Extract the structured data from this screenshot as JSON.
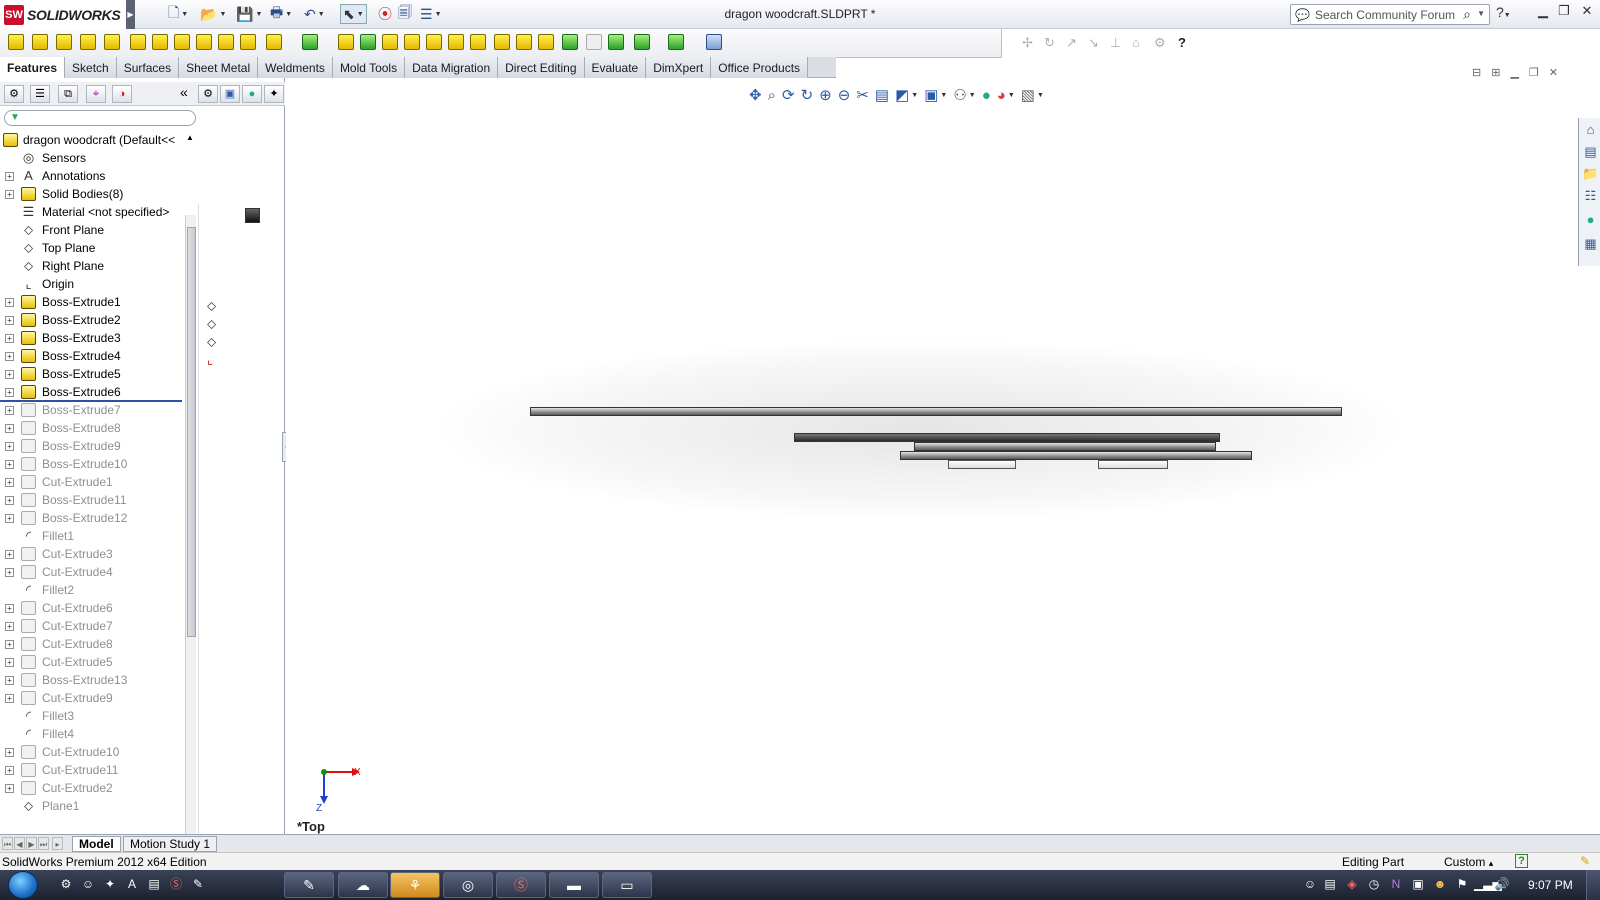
{
  "app": {
    "brand": "SOLIDWORKS",
    "brand_letters": "SW",
    "document_title": "dragon woodcraft.SLDPRT *",
    "search_placeholder": "Search Community Forum",
    "help_glyph": "?",
    "window_controls": [
      "minimize-icon",
      "restore-icon",
      "close-icon"
    ]
  },
  "tabs": [
    "Features",
    "Sketch",
    "Surfaces",
    "Sheet Metal",
    "Weldments",
    "Mold Tools",
    "Data Migration",
    "Direct Editing",
    "Evaluate",
    "DimXpert",
    "Office Products"
  ],
  "active_tab": "Features",
  "feature_tree": {
    "root": "dragon woodcraft  (Default<<",
    "items": [
      {
        "label": "Sensors",
        "icon": "sensor-icon",
        "expandable": false,
        "suppressed": false
      },
      {
        "label": "Annotations",
        "icon": "annotations-icon",
        "expandable": true,
        "suppressed": false
      },
      {
        "label": "Solid Bodies(8)",
        "icon": "solid-bodies-icon",
        "expandable": true,
        "suppressed": false
      },
      {
        "label": "Material <not specified>",
        "icon": "material-icon",
        "expandable": false,
        "suppressed": false
      },
      {
        "label": "Front Plane",
        "icon": "plane-icon",
        "expandable": false,
        "suppressed": false
      },
      {
        "label": "Top Plane",
        "icon": "plane-icon",
        "expandable": false,
        "suppressed": false
      },
      {
        "label": "Right Plane",
        "icon": "plane-icon",
        "expandable": false,
        "suppressed": false
      },
      {
        "label": "Origin",
        "icon": "origin-icon",
        "expandable": false,
        "suppressed": false
      },
      {
        "label": "Boss-Extrude1",
        "icon": "extrude-icon",
        "expandable": true,
        "suppressed": false
      },
      {
        "label": "Boss-Extrude2",
        "icon": "extrude-icon",
        "expandable": true,
        "suppressed": false
      },
      {
        "label": "Boss-Extrude3",
        "icon": "extrude-icon",
        "expandable": true,
        "suppressed": false
      },
      {
        "label": "Boss-Extrude4",
        "icon": "extrude-icon",
        "expandable": true,
        "suppressed": false
      },
      {
        "label": "Boss-Extrude5",
        "icon": "extrude-icon",
        "expandable": true,
        "suppressed": false
      },
      {
        "label": "Boss-Extrude6",
        "icon": "extrude-icon",
        "expandable": true,
        "suppressed": false
      },
      {
        "label": "Boss-Extrude7",
        "icon": "extrude-icon",
        "expandable": true,
        "suppressed": true
      },
      {
        "label": "Boss-Extrude8",
        "icon": "extrude-icon",
        "expandable": true,
        "suppressed": true
      },
      {
        "label": "Boss-Extrude9",
        "icon": "extrude-icon",
        "expandable": true,
        "suppressed": true
      },
      {
        "label": "Boss-Extrude10",
        "icon": "extrude-icon",
        "expandable": true,
        "suppressed": true
      },
      {
        "label": "Cut-Extrude1",
        "icon": "cut-extrude-icon",
        "expandable": true,
        "suppressed": true
      },
      {
        "label": "Boss-Extrude11",
        "icon": "extrude-icon",
        "expandable": true,
        "suppressed": true
      },
      {
        "label": "Boss-Extrude12",
        "icon": "extrude-icon",
        "expandable": true,
        "suppressed": true
      },
      {
        "label": "Fillet1",
        "icon": "fillet-icon",
        "expandable": false,
        "suppressed": true
      },
      {
        "label": "Cut-Extrude3",
        "icon": "cut-extrude-icon",
        "expandable": true,
        "suppressed": true
      },
      {
        "label": "Cut-Extrude4",
        "icon": "cut-extrude-icon",
        "expandable": true,
        "suppressed": true
      },
      {
        "label": "Fillet2",
        "icon": "fillet-icon",
        "expandable": false,
        "suppressed": true
      },
      {
        "label": "Cut-Extrude6",
        "icon": "cut-extrude-icon",
        "expandable": true,
        "suppressed": true
      },
      {
        "label": "Cut-Extrude7",
        "icon": "cut-extrude-icon",
        "expandable": true,
        "suppressed": true
      },
      {
        "label": "Cut-Extrude8",
        "icon": "cut-extrude-icon",
        "expandable": true,
        "suppressed": true
      },
      {
        "label": "Cut-Extrude5",
        "icon": "cut-extrude-icon",
        "expandable": true,
        "suppressed": true
      },
      {
        "label": "Boss-Extrude13",
        "icon": "extrude-icon",
        "expandable": true,
        "suppressed": true
      },
      {
        "label": "Cut-Extrude9",
        "icon": "cut-extrude-icon",
        "expandable": true,
        "suppressed": true
      },
      {
        "label": "Fillet3",
        "icon": "fillet-icon",
        "expandable": false,
        "suppressed": true
      },
      {
        "label": "Fillet4",
        "icon": "fillet-icon",
        "expandable": false,
        "suppressed": true
      },
      {
        "label": "Cut-Extrude10",
        "icon": "cut-extrude-icon",
        "expandable": true,
        "suppressed": true
      },
      {
        "label": "Cut-Extrude11",
        "icon": "cut-extrude-icon",
        "expandable": true,
        "suppressed": true
      },
      {
        "label": "Cut-Extrude2",
        "icon": "cut-extrude-icon",
        "expandable": true,
        "suppressed": true
      },
      {
        "label": "Plane1",
        "icon": "plane-icon",
        "expandable": false,
        "suppressed": true
      }
    ]
  },
  "viewport": {
    "view_name": "*Top",
    "triad_x": "X",
    "triad_z": "Z"
  },
  "bottom_tabs": [
    "Model",
    "Motion Study 1"
  ],
  "active_bottom_tab": "Model",
  "status_bar": {
    "edition": "SolidWorks Premium 2012 x64 Edition",
    "mode": "Editing Part",
    "units": "Custom",
    "units_arrow": "▴",
    "help_glyph": "?"
  },
  "taskbar": {
    "clock": "9:07 PM"
  },
  "colors": {
    "brand_red": "#c8102e",
    "rollback_bar": "#2f4fa8",
    "suppressed_text": "#8c8f94"
  }
}
